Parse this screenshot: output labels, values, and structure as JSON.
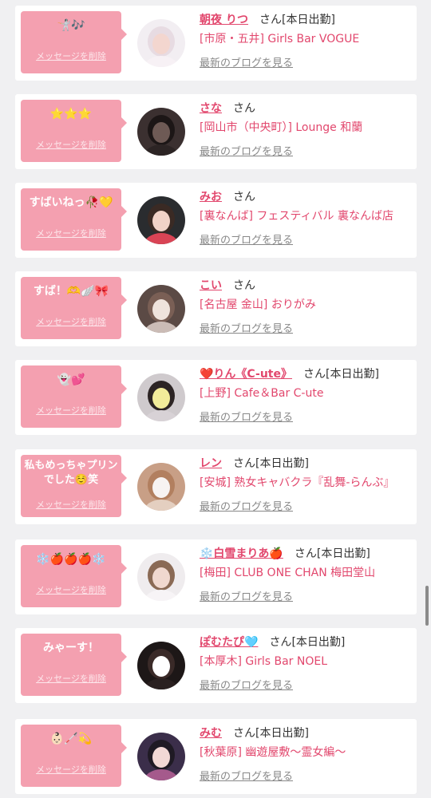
{
  "messages": [
    {
      "message": "🤺🎶",
      "delete_label": "メッセージを削除",
      "name": "朝夜 りつ",
      "honorific": "さん",
      "status": "[本日出勤]",
      "shop": "[市原・五井] Girls Bar VOGUE",
      "blog_label": "最新のブログを見る",
      "avatar": {
        "bg": "#f2eef2",
        "skin": "#f3d6cf",
        "hair": "#e7dbe2",
        "cloth": "#f7f1f5"
      }
    },
    {
      "message": "⭐⭐⭐",
      "delete_label": "メッセージを削除",
      "name": "さな",
      "honorific": "さん",
      "status": "",
      "shop": "[岡山市（中央町）] Lounge 和蘭",
      "blog_label": "最新のブログを見る",
      "avatar": {
        "bg": "#3b3030",
        "skin": "#6e5a55",
        "hair": "#1c1616",
        "cloth": "#2c2424"
      }
    },
    {
      "message": "すばいねっ🥀💛",
      "delete_label": "メッセージを削除",
      "name": "みお",
      "honorific": "さん",
      "status": "",
      "shop": "[裏なんば] フェスティバル 裏なんば店",
      "blog_label": "最新のブログを見る",
      "avatar": {
        "bg": "#2a2c2f",
        "skin": "#f1d3c8",
        "hair": "#3a2a24",
        "cloth": "#d94455"
      }
    },
    {
      "message": "すば！🫶🪽🎀",
      "delete_label": "メッセージを削除",
      "name": "こい",
      "honorific": "さん",
      "status": "",
      "shop": "[名古屋 金山] おりがみ",
      "blog_label": "最新のブログを見る",
      "avatar": {
        "bg": "#5b4a45",
        "skin": "#efe3dc",
        "hair": "#7a5f55",
        "cloth": "#cbbcb6"
      }
    },
    {
      "message": "👻💕",
      "delete_label": "メッセージを削除",
      "name": "❤️りん《C-ute》",
      "honorific": "さん",
      "status": "[本日出勤]",
      "shop": "[上野] Cafe＆Bar C-ute",
      "blog_label": "最新のブログを見る",
      "avatar": {
        "bg": "#cfcacd",
        "skin": "#f2ec9a",
        "hair": "#2c2424",
        "cloth": "#d8d2d6"
      }
    },
    {
      "message": "私もめっちゃプリンでした☺️笑",
      "delete_label": "メッセージを削除",
      "name": "レン",
      "honorific": "さん",
      "status": "[本日出勤]",
      "shop": "[安城] 熟女キャバクラ『乱舞-らんぶ』",
      "blog_label": "最新のブログを見る",
      "avatar": {
        "bg": "#c89f86",
        "skin": "#f7f3f2",
        "hair": "#b27f5f",
        "cloth": "#e4cfc0"
      }
    },
    {
      "message": "❄️🍎🍎🍎❄️",
      "delete_label": "メッセージを削除",
      "name": "❄️白雪まりあ🍎",
      "honorific": "さん",
      "status": "[本日出勤]",
      "shop": "[梅田] CLUB ONE CHAN 梅田堂山",
      "blog_label": "最新のブログを見る",
      "avatar": {
        "bg": "#efecee",
        "skin": "#f0d8cf",
        "hair": "#8a6a55",
        "cloth": "#f7f4f6"
      }
    },
    {
      "message": "みゃーす！",
      "delete_label": "メッセージを削除",
      "name": "ぽむたぴ🩵",
      "honorific": "さん",
      "status": "[本日出勤]",
      "shop": "[本厚木] Girls Bar NOEL",
      "blog_label": "最新のブログを見る",
      "avatar": {
        "bg": "#1d1717",
        "skin": "#ffffff",
        "hair": "#3a2a28",
        "cloth": "#2a2020"
      }
    },
    {
      "message": "👶🏻🦯💫",
      "delete_label": "メッセージを削除",
      "name": "みむ",
      "honorific": "さん",
      "status": "[本日出勤]",
      "shop": "[秋葉原] 幽遊屋敷〜霊女編〜",
      "blog_label": "最新のブログを見る",
      "avatar": {
        "bg": "#3b2e4a",
        "skin": "#f2d8d5",
        "hair": "#1f1a24",
        "cloth": "#a55a8c"
      }
    }
  ]
}
